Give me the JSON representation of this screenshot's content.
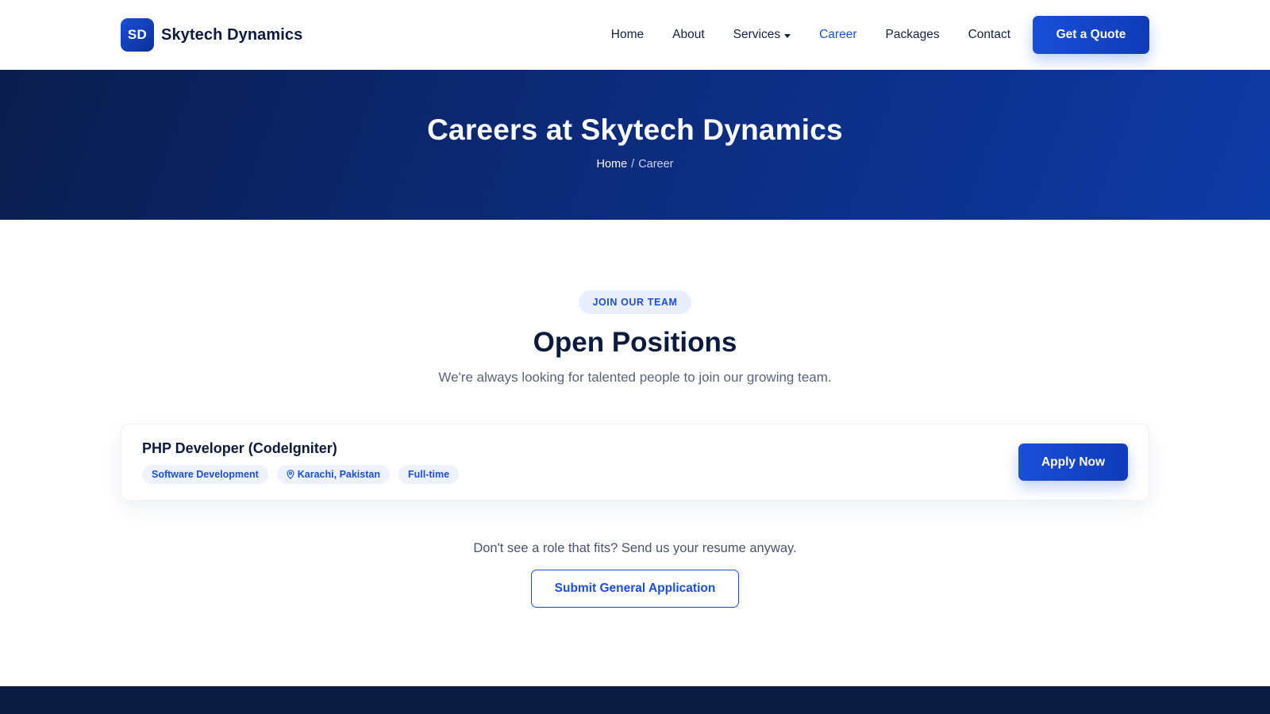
{
  "header": {
    "logo_text": "SD",
    "brand_name": "Skytech Dynamics",
    "nav": [
      {
        "label": "Home"
      },
      {
        "label": "About"
      },
      {
        "label": "Services"
      },
      {
        "label": "Career"
      },
      {
        "label": "Packages"
      },
      {
        "label": "Contact"
      }
    ],
    "active_nav": "Career",
    "quote_button": "Get a Quote"
  },
  "hero": {
    "title": "Careers at Skytech Dynamics",
    "breadcrumb": {
      "home": "Home",
      "separator": "/",
      "current": "Career"
    }
  },
  "positions": {
    "badge": "JOIN OUR TEAM",
    "title": "Open Positions",
    "subtitle": "We're always looking for talented people to join our growing team.",
    "jobs": [
      {
        "title": "PHP Developer (CodeIgniter)",
        "department": "Software Development",
        "location": "Karachi, Pakistan",
        "type": "Full-time",
        "apply_label": "Apply Now"
      }
    ]
  },
  "cta": {
    "text": "Don't see a role that fits? Send us your resume anyway.",
    "button": "Submit General Application"
  },
  "colors": {
    "accent": "#1a4fd8",
    "hero_dark": "#0a1d4d",
    "hero_light": "#0e3aa6",
    "text_dark": "#0b1a3d",
    "footer": "#0a1a40"
  },
  "icons": {
    "services_dropdown": "chevron-down-icon",
    "location": "map-pin-icon"
  }
}
